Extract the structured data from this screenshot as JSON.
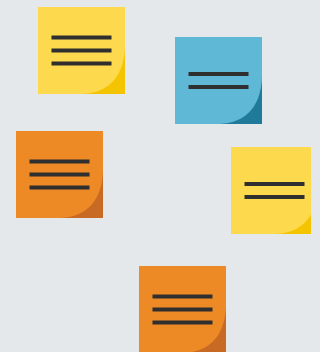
{
  "notes": [
    {
      "icon": "sticky-note-icon",
      "color": "#fdd94d",
      "fold": "#f5c400",
      "lines": 3
    },
    {
      "icon": "sticky-note-icon",
      "color": "#5fb9d6",
      "fold": "#1f7b99",
      "lines": 2
    },
    {
      "icon": "sticky-note-icon",
      "color": "#ee8a26",
      "fold": "#c86a23",
      "lines": 3
    },
    {
      "icon": "sticky-note-icon",
      "color": "#fdd94d",
      "fold": "#f5c400",
      "lines": 2
    },
    {
      "icon": "sticky-note-icon",
      "color": "#ee8a26",
      "fold": "#c86a23",
      "lines": 3
    }
  ],
  "line_color": "#2f2f2f",
  "background": "#e5e8eb"
}
